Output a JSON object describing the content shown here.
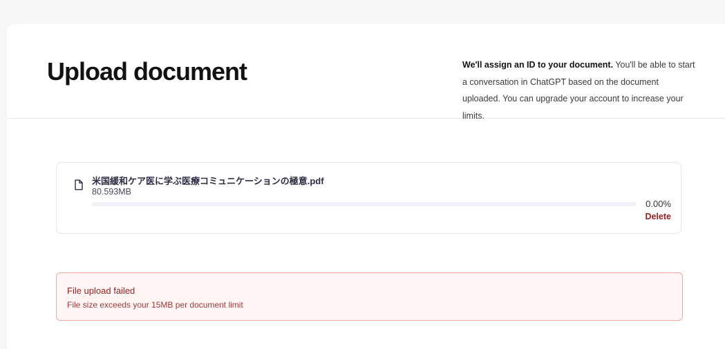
{
  "header": {
    "title": "Upload document",
    "info_bold": "We'll assign an ID to your document.",
    "info_rest": " You'll be able to start a conversation in ChatGPT based on the document uploaded. You can upgrade your account to increase your limits."
  },
  "file": {
    "icon": "file-icon",
    "name": "米国緩和ケア医に学ぶ医療コミュニケーションの極意.pdf",
    "size": "80.593MB",
    "progress": 0,
    "progress_label": "0.00%",
    "delete_label": "Delete"
  },
  "error": {
    "title": "File upload failed",
    "message": "File size exceeds your 15MB per document limit"
  },
  "colors": {
    "error_text": "#9b1d1d",
    "error_border": "#f0a7a2",
    "error_bg": "#fff5f4",
    "progress_track": "#f1f1f8"
  }
}
